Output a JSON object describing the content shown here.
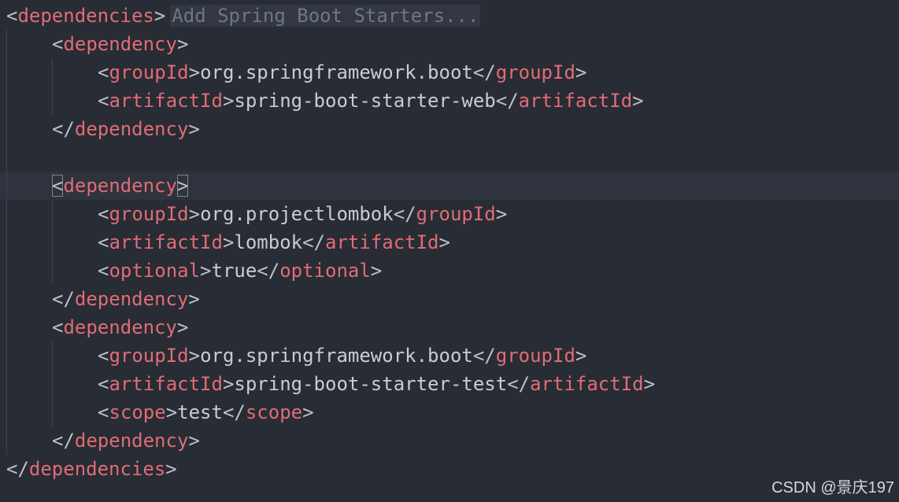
{
  "editor": {
    "lines": [
      {
        "indent": 0,
        "open": "dependencies",
        "hint": "Add Spring Boot Starters..."
      },
      {
        "indent": 1,
        "open": "dependency"
      },
      {
        "indent": 2,
        "open": "groupId",
        "text": "org.springframework.boot",
        "close": "groupId"
      },
      {
        "indent": 2,
        "open": "artifactId",
        "text": "spring-boot-starter-web",
        "close": "artifactId"
      },
      {
        "indent": 1,
        "close": "dependency"
      },
      {
        "blank": true
      },
      {
        "indent": 1,
        "open": "dependency",
        "current": true,
        "bracket_match": true
      },
      {
        "indent": 2,
        "open": "groupId",
        "text": "org.projectlombok",
        "close": "groupId"
      },
      {
        "indent": 2,
        "open": "artifactId",
        "text": "lombok",
        "close": "artifactId"
      },
      {
        "indent": 2,
        "open": "optional",
        "text": "true",
        "close": "optional"
      },
      {
        "indent": 1,
        "close": "dependency"
      },
      {
        "indent": 1,
        "open": "dependency"
      },
      {
        "indent": 2,
        "open": "groupId",
        "text": "org.springframework.boot",
        "close": "groupId"
      },
      {
        "indent": 2,
        "open": "artifactId",
        "text": "spring-boot-starter-test",
        "close": "artifactId"
      },
      {
        "indent": 2,
        "open": "scope",
        "text": "test",
        "close": "scope"
      },
      {
        "indent": 1,
        "close": "dependency"
      },
      {
        "indent": 0,
        "close": "dependencies"
      }
    ]
  },
  "watermark": "CSDN @景庆197",
  "colors": {
    "background": "#282c34",
    "tag": "#e06c75",
    "punctuation": "#bcc1cb",
    "hint": "#6f7785",
    "current_line": "#2f333d"
  }
}
